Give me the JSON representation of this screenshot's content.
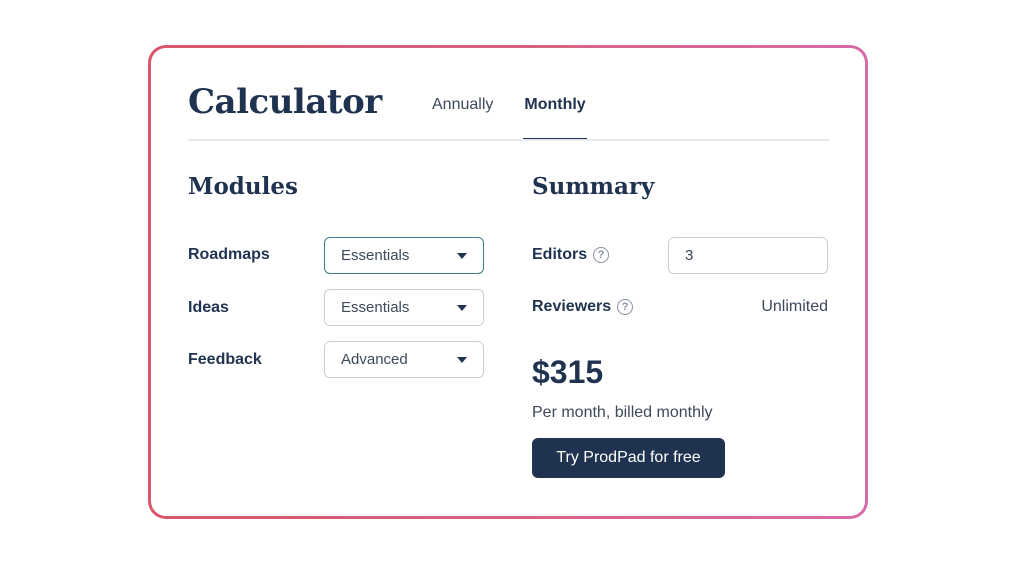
{
  "calculator": {
    "title": "Calculator",
    "tabs": [
      {
        "label": "Annually",
        "active": false
      },
      {
        "label": "Monthly",
        "active": true
      }
    ]
  },
  "modules": {
    "title": "Modules",
    "rows": [
      {
        "label": "Roadmaps",
        "value": "Essentials"
      },
      {
        "label": "Ideas",
        "value": "Essentials"
      },
      {
        "label": "Feedback",
        "value": "Advanced"
      }
    ]
  },
  "summary": {
    "title": "Summary",
    "editors_label": "Editors",
    "editors_value": "3",
    "reviewers_label": "Reviewers",
    "reviewers_value": "Unlimited",
    "price": "$315",
    "billing_note": "Per month, billed monthly",
    "cta_label": "Try ProdPad for free"
  },
  "icons": {
    "help": "question-mark-circle-icon",
    "caret": "caret-down-icon"
  },
  "colors": {
    "primary": "#1f3350",
    "border_gradient_start": "#d9566a",
    "border_gradient_end": "#d56ba6",
    "focus": "#3e7d8a"
  }
}
